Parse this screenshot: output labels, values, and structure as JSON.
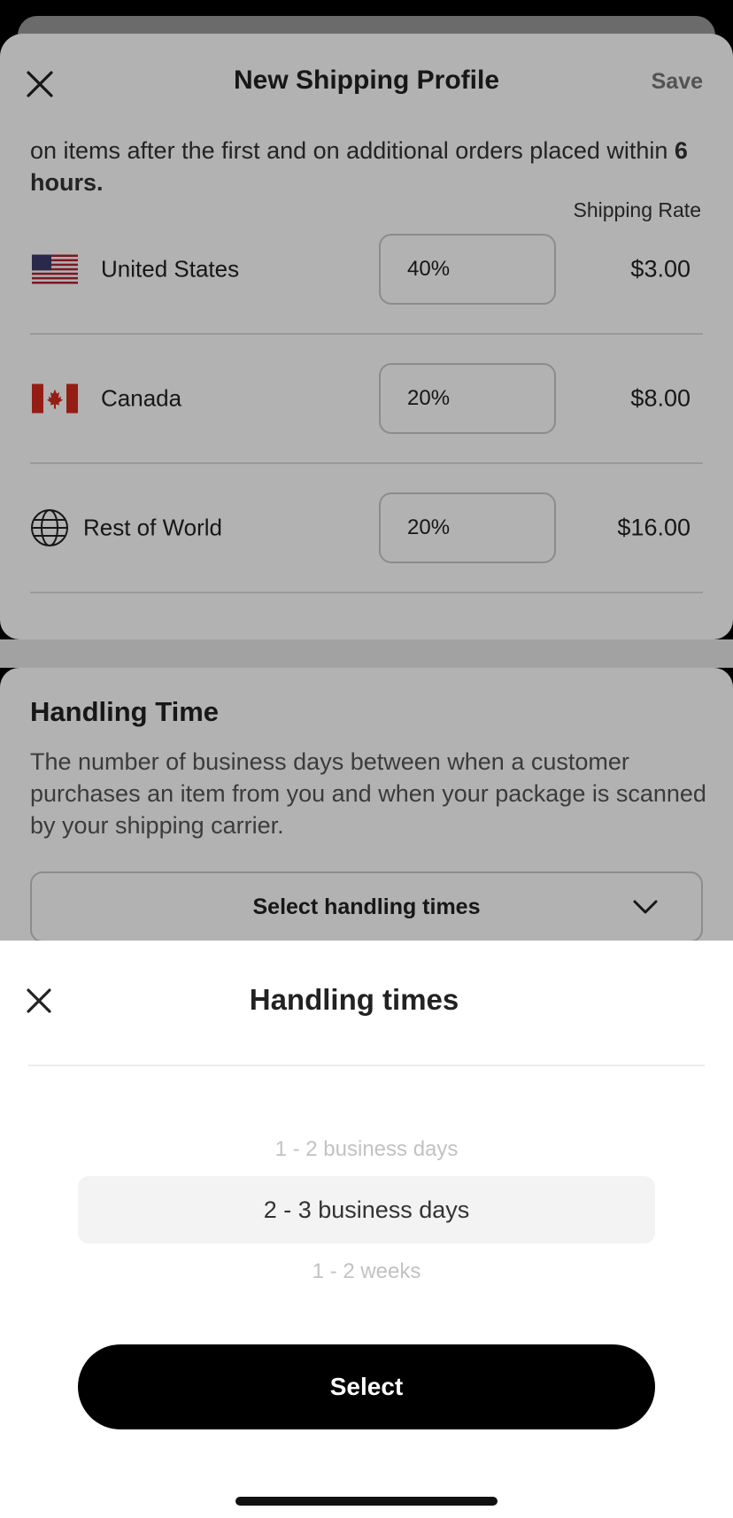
{
  "header": {
    "title": "New Shipping Profile",
    "save_label": "Save"
  },
  "intro": {
    "text": "on items after the first and on additional orders placed within ",
    "bold": "6 hours."
  },
  "rates": {
    "column_label": "Shipping Rate",
    "rows": [
      {
        "country": "United States",
        "percent": "40%",
        "price": "$3.00",
        "icon": "us-flag-icon"
      },
      {
        "country": "Canada",
        "percent": "20%",
        "price": "$8.00",
        "icon": "canada-flag-icon"
      },
      {
        "country": "Rest of World",
        "percent": "20%",
        "price": "$16.00",
        "icon": "globe-icon"
      }
    ]
  },
  "handling": {
    "title": "Handling Time",
    "description": "The number of business days between when a customer purchases an item from you and when your package is scanned by your shipping carrier.",
    "select_label": "Select handling times"
  },
  "sheet": {
    "title": "Handling times",
    "options": [
      "1 - 2 business days",
      "2 - 3 business days",
      "1 - 2 weeks"
    ],
    "selected": "2 - 3 business days",
    "select_button": "Select"
  },
  "colors": {
    "accent": "#000000",
    "overlay": "rgba(0,0,0,0.30)"
  }
}
